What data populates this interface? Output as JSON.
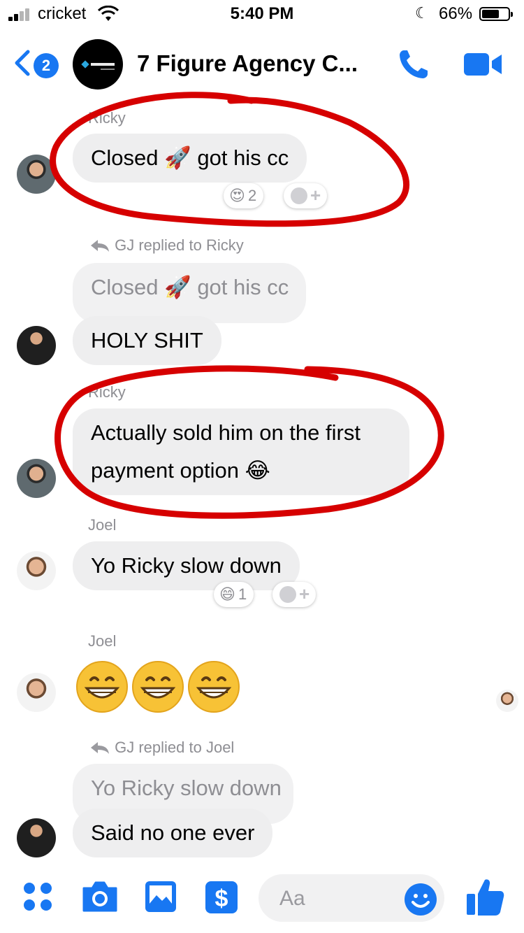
{
  "status_bar": {
    "carrier": "cricket",
    "time": "5:40 PM",
    "battery_percent": "66%",
    "battery_level": 0.66,
    "icons": [
      "signal-icon",
      "wifi-icon",
      "moon-icon",
      "battery-icon"
    ]
  },
  "header": {
    "back_badge": "2",
    "title": "7 Figure Agency C...",
    "icons": [
      "back-chevron-icon",
      "phone-icon",
      "video-camera-icon"
    ]
  },
  "messages": [
    {
      "sender": "Ricky",
      "text_before": "Closed",
      "emoji": "🚀",
      "text_after": "got his cc",
      "reaction": {
        "emoji": "😍",
        "count": "2"
      }
    },
    {
      "reply_meta": "GJ replied to Ricky",
      "quoted": "Closed 🚀 got his cc",
      "text": "HOLY SHIT"
    },
    {
      "sender": "Ricky",
      "line1": "Actually sold him on the first",
      "line2": "payment option",
      "emoji": "😂"
    },
    {
      "sender": "Joel",
      "text": "Yo Ricky slow down",
      "reaction": {
        "emoji": "😄",
        "count": "1"
      }
    },
    {
      "sender": "Joel",
      "big_emojis": [
        "grin-icon",
        "grin-icon",
        "grin-icon"
      ]
    },
    {
      "reply_meta": "GJ replied to Joel",
      "quoted": "Yo Ricky slow down",
      "text": "Said no one ever"
    }
  ],
  "composer": {
    "placeholder": "Aa",
    "icons": [
      "apps-grid-icon",
      "camera-icon",
      "gallery-icon",
      "payment-dollar-icon",
      "emoji-icon",
      "thumbs-up-icon"
    ]
  },
  "colors": {
    "accent": "#1877f2",
    "bubble": "#eeeeef",
    "annotation": "#d60000"
  }
}
